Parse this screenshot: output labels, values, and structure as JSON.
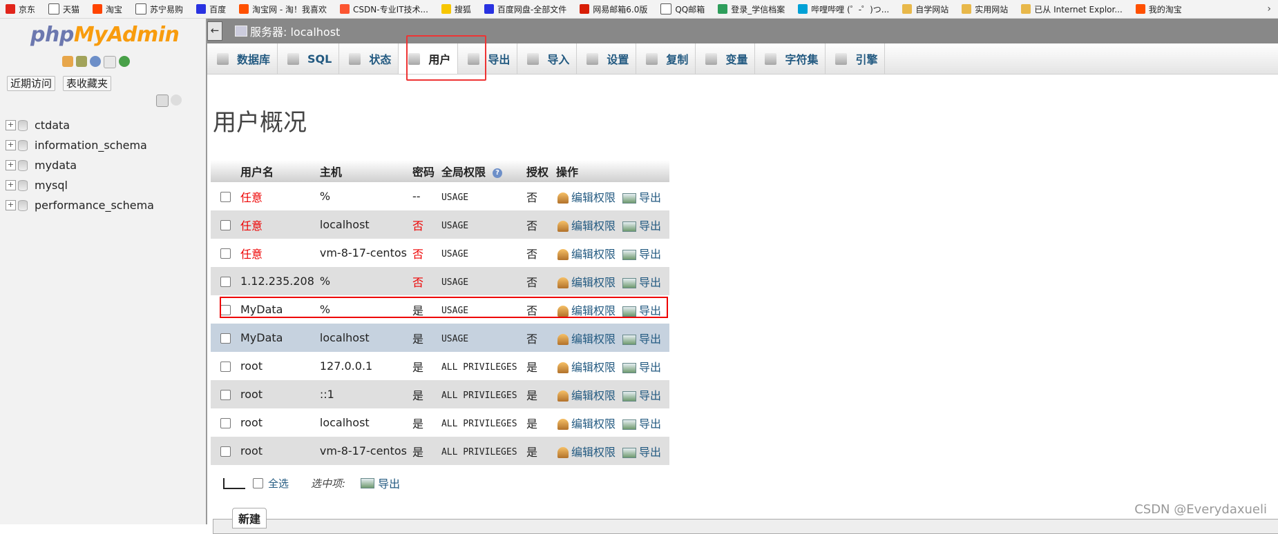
{
  "bookmarks": {
    "items": [
      {
        "label": "京东",
        "icon": "jd-icon",
        "color": "#e1251b"
      },
      {
        "label": "天猫",
        "icon": "page-icon",
        "color": "#ffffff"
      },
      {
        "label": "淘宝",
        "icon": "taobao-t-icon",
        "color": "#ff4400"
      },
      {
        "label": "苏宁易购",
        "icon": "page-icon",
        "color": "#ffffff"
      },
      {
        "label": "百度",
        "icon": "baidu-paw-icon",
        "color": "#2932e1"
      },
      {
        "label": "淘宝网 - 淘！我喜欢",
        "icon": "taobao-icon",
        "color": "#ff5000"
      },
      {
        "label": "CSDN-专业IT技术...",
        "icon": "csdn-icon",
        "color": "#fc5531"
      },
      {
        "label": "搜狐",
        "icon": "sohu-icon",
        "color": "#f7c600"
      },
      {
        "label": "百度网盘-全部文件",
        "icon": "baidu-paw-icon",
        "color": "#2932e1"
      },
      {
        "label": "网易邮箱6.0版",
        "icon": "netease-icon",
        "color": "#d81e06"
      },
      {
        "label": "QQ邮箱",
        "icon": "page-icon",
        "color": "#ffffff"
      },
      {
        "label": "登录_学信档案",
        "icon": "chsi-icon",
        "color": "#2e9e5b"
      },
      {
        "label": "哔哩哔哩 (゜-゜)つ...",
        "icon": "bilibili-icon",
        "color": "#00a1d6"
      },
      {
        "label": "自学网站",
        "icon": "folder-icon",
        "color": "#e8b84a"
      },
      {
        "label": "实用网站",
        "icon": "folder-icon",
        "color": "#e8b84a"
      },
      {
        "label": "已从 Internet Explor...",
        "icon": "folder-icon",
        "color": "#e8b84a"
      },
      {
        "label": "我的淘宝",
        "icon": "taobao-icon",
        "color": "#ff5000"
      }
    ]
  },
  "sidebar": {
    "logo_php": "php",
    "logo_myadmin": "MyAdmin",
    "recent_button": "近期访问",
    "favorites_button": "表收藏夹",
    "databases": [
      "ctdata",
      "information_schema",
      "mydata",
      "mysql",
      "performance_schema"
    ]
  },
  "header": {
    "back_label": "←",
    "server": "服务器: localhost"
  },
  "tabs": [
    {
      "label": "数据库",
      "icon": "database-icon",
      "active": false
    },
    {
      "label": "SQL",
      "icon": "sql-icon",
      "active": false
    },
    {
      "label": "状态",
      "icon": "status-icon",
      "active": false
    },
    {
      "label": "用户",
      "icon": "users-icon",
      "active": true
    },
    {
      "label": "导出",
      "icon": "export-icon",
      "active": false
    },
    {
      "label": "导入",
      "icon": "import-icon",
      "active": false
    },
    {
      "label": "设置",
      "icon": "settings-icon",
      "active": false
    },
    {
      "label": "复制",
      "icon": "replication-icon",
      "active": false
    },
    {
      "label": "变量",
      "icon": "variables-icon",
      "active": false
    },
    {
      "label": "字符集",
      "icon": "charset-icon",
      "active": false
    },
    {
      "label": "引擎",
      "icon": "engine-icon",
      "active": false
    }
  ],
  "main": {
    "title": "用户概况",
    "columns": [
      "用户名",
      "主机",
      "密码",
      "全局权限",
      "授权",
      "操作"
    ],
    "edit_label": "编辑权限",
    "export_label": "导出",
    "rows": [
      {
        "user": "任意",
        "user_red": true,
        "host": "%",
        "password": "--",
        "pw_red": false,
        "privileges": "USAGE",
        "grant": "否"
      },
      {
        "user": "任意",
        "user_red": true,
        "host": "localhost",
        "password": "否",
        "pw_red": true,
        "privileges": "USAGE",
        "grant": "否"
      },
      {
        "user": "任意",
        "user_red": true,
        "host": "vm-8-17-centos",
        "password": "否",
        "pw_red": true,
        "privileges": "USAGE",
        "grant": "否"
      },
      {
        "user": "1.12.235.208",
        "user_red": false,
        "host": "%",
        "password": "否",
        "pw_red": true,
        "privileges": "USAGE",
        "grant": "否"
      },
      {
        "user": "MyData",
        "user_red": false,
        "host": "%",
        "password": "是",
        "pw_red": false,
        "privileges": "USAGE",
        "grant": "否"
      },
      {
        "user": "MyData",
        "user_red": false,
        "host": "localhost",
        "password": "是",
        "pw_red": false,
        "privileges": "USAGE",
        "grant": "否"
      },
      {
        "user": "root",
        "user_red": false,
        "host": "127.0.0.1",
        "password": "是",
        "pw_red": false,
        "privileges": "ALL PRIVILEGES",
        "grant": "是"
      },
      {
        "user": "root",
        "user_red": false,
        "host": "::1",
        "password": "是",
        "pw_red": false,
        "privileges": "ALL PRIVILEGES",
        "grant": "是"
      },
      {
        "user": "root",
        "user_red": false,
        "host": "localhost",
        "password": "是",
        "pw_red": false,
        "privileges": "ALL PRIVILEGES",
        "grant": "是"
      },
      {
        "user": "root",
        "user_red": false,
        "host": "vm-8-17-centos",
        "password": "是",
        "pw_red": false,
        "privileges": "ALL PRIVILEGES",
        "grant": "是"
      }
    ],
    "select_all": "全选",
    "with_selected": "选中项:",
    "bulk_export": "导出",
    "new_legend": "新建"
  },
  "watermark": "CSDN @Everydaxueli"
}
